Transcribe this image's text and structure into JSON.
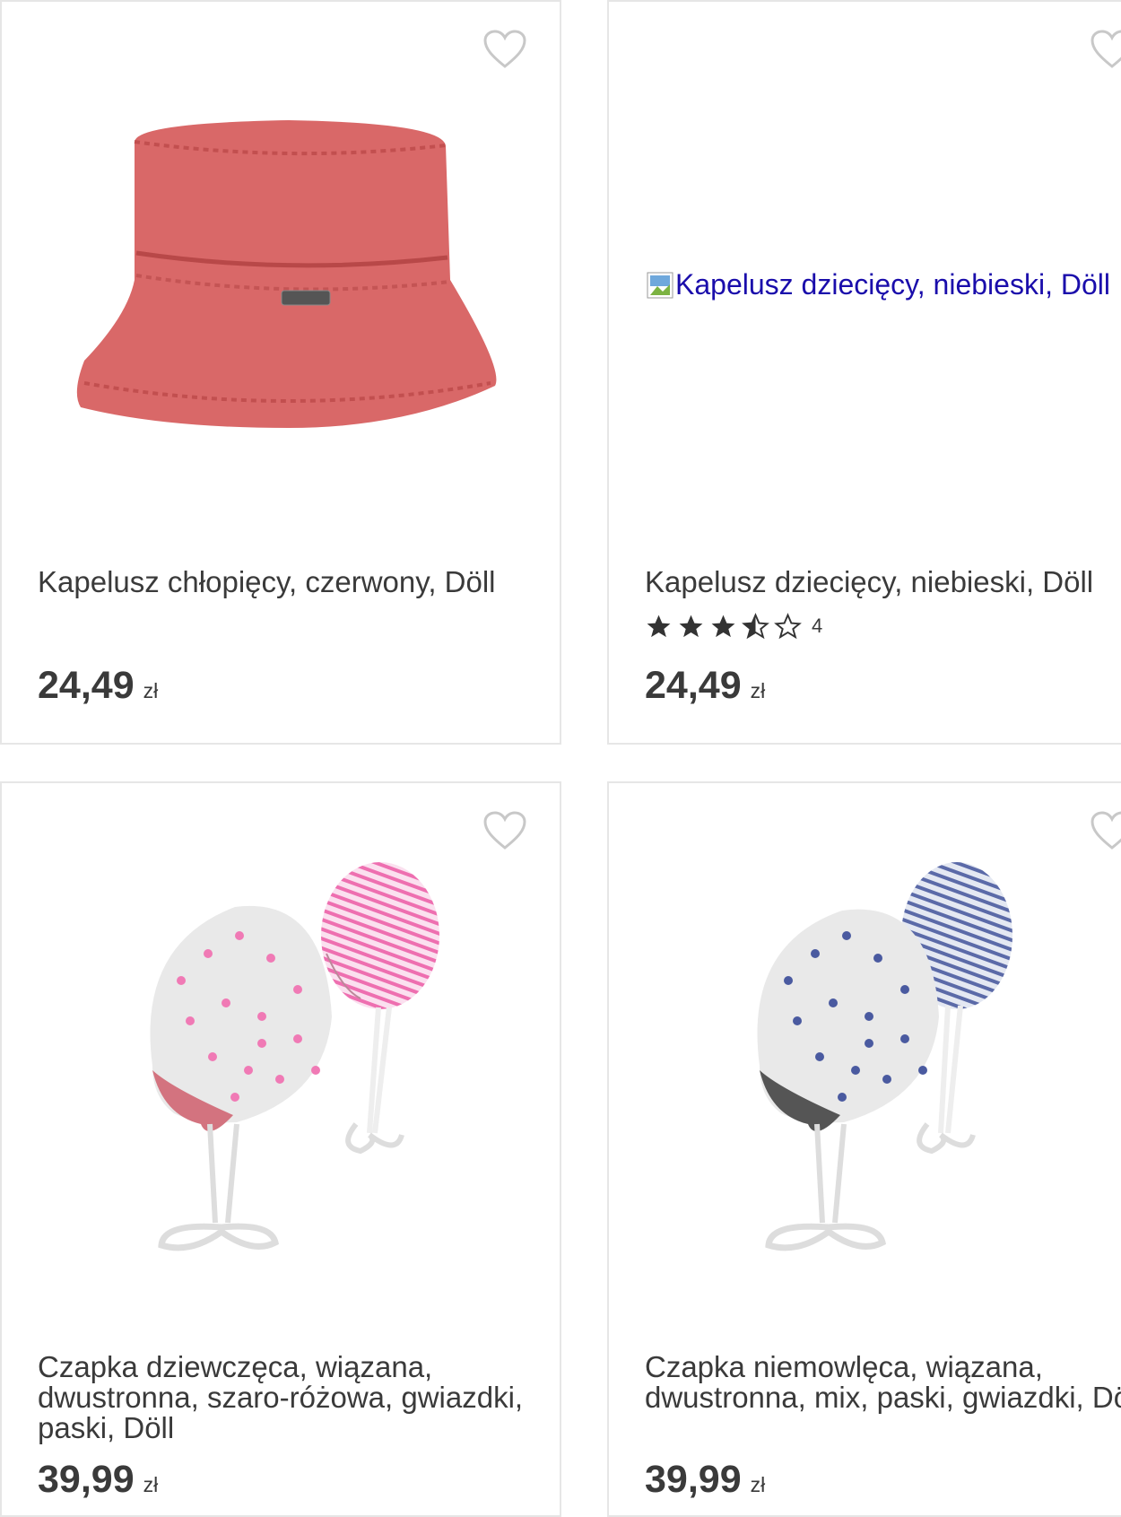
{
  "products": [
    {
      "title": "Kapelusz chłopięcy, czerwony, Döll",
      "price": "24,49",
      "currency": "zł",
      "favorite_icon": "heart-outline-icon"
    },
    {
      "title": "Kapelusz dziecięcy, niebieski, Döll",
      "image_alt": "Kapelusz dziecięcy, niebieski, Döll",
      "price": "24,49",
      "currency": "zł",
      "rating": {
        "value": 3.5,
        "max": 5,
        "count": "4"
      },
      "favorite_icon": "heart-outline-icon"
    },
    {
      "title": "Czapka dziewczęca, wiązana, dwustronna, szaro-różowa, gwiazdki, paski, Döll",
      "price": "39,99",
      "currency": "zł",
      "favorite_icon": "heart-outline-icon"
    },
    {
      "title": "Czapka niemowlęca, wiązana, dwustronna, mix, paski, gwiazdki, Döll",
      "price": "39,99",
      "currency": "zł",
      "favorite_icon": "heart-outline-icon"
    }
  ],
  "colors": {
    "text": "#3a3a3a",
    "border": "#e6e6e6",
    "link": "#1a0dab",
    "hat_red": "#d96060",
    "pink_star": "#f07ab5",
    "blue_star": "#4a5aa0"
  }
}
